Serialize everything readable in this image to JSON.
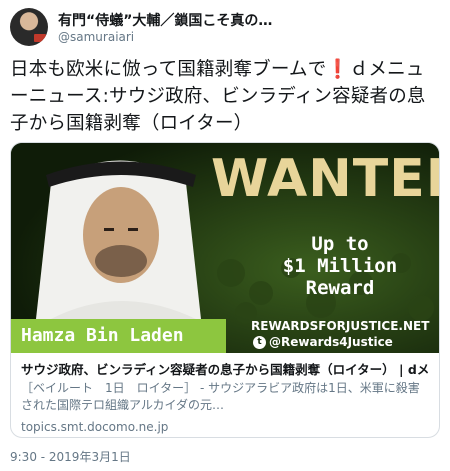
{
  "tweet": {
    "display_name": "有門“侍蟻”大輔／鎖国こそ真の…",
    "handle": "@samuraiari",
    "text_part1": "日本も欧米に倣って国籍剥奪ブームで",
    "bang": "❗",
    "text_part2": "ｄメニューニュース:サウジ政府、ビンラディン容疑者の息子から国籍剥奪（ロイター）",
    "timestamp": "9:30 - 2019年3月1日"
  },
  "card": {
    "image": {
      "wanted": "WANTED",
      "reward_line1": "Up to",
      "reward_line2": "$1 Million",
      "reward_line3": "Reward",
      "name_plate": "Hamza Bin Laden",
      "site": "REWARDSFORJUSTICE.NET",
      "twitter_handle": "@Rewards4Justice"
    },
    "title": "サウジ政府、ビンラディン容疑者の息子から国籍剥奪（ロイター） | dメニューニュース",
    "description": "［ベイルート　1日　ロイター］ - サウジアラビア政府は1日、米軍に殺害された国際テロ組織アルカイダの元…",
    "url": "topics.smt.docomo.ne.jp"
  },
  "colors": {
    "accent_green": "#8dc63f",
    "wanted_gold": "#e8d59a",
    "muted": "#657786"
  }
}
